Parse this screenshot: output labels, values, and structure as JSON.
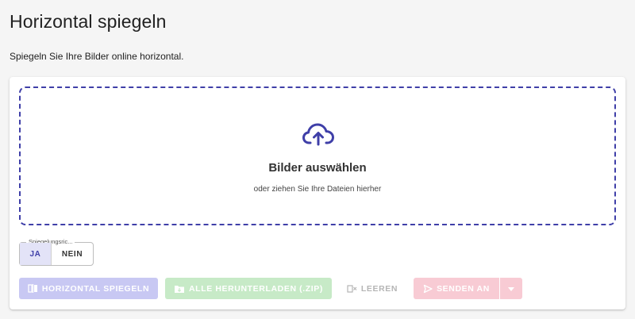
{
  "page": {
    "title": "Horizontal spiegeln",
    "subtitle": "Spiegeln Sie Ihre Bilder online horizontal."
  },
  "dropzone": {
    "title": "Bilder auswählen",
    "hint": "oder ziehen Sie Ihre Dateien hierher",
    "icon": "cloud-upload-icon"
  },
  "mirror_option": {
    "legend": "Spiegelungsric...",
    "options": [
      "JA",
      "NEIN"
    ],
    "selected": "JA"
  },
  "actions": {
    "mirror_label": "HORIZONTAL SPIEGELN",
    "download_label": "ALLE HERUNTERLADEN (.ZIP)",
    "clear_label": "LEEREN",
    "send_label": "SENDEN AN"
  },
  "colors": {
    "accent": "#3f3fa8",
    "mirror_button": "#c8c8f3",
    "download_button": "#c7eac7",
    "send_button": "#f8cbd4"
  }
}
